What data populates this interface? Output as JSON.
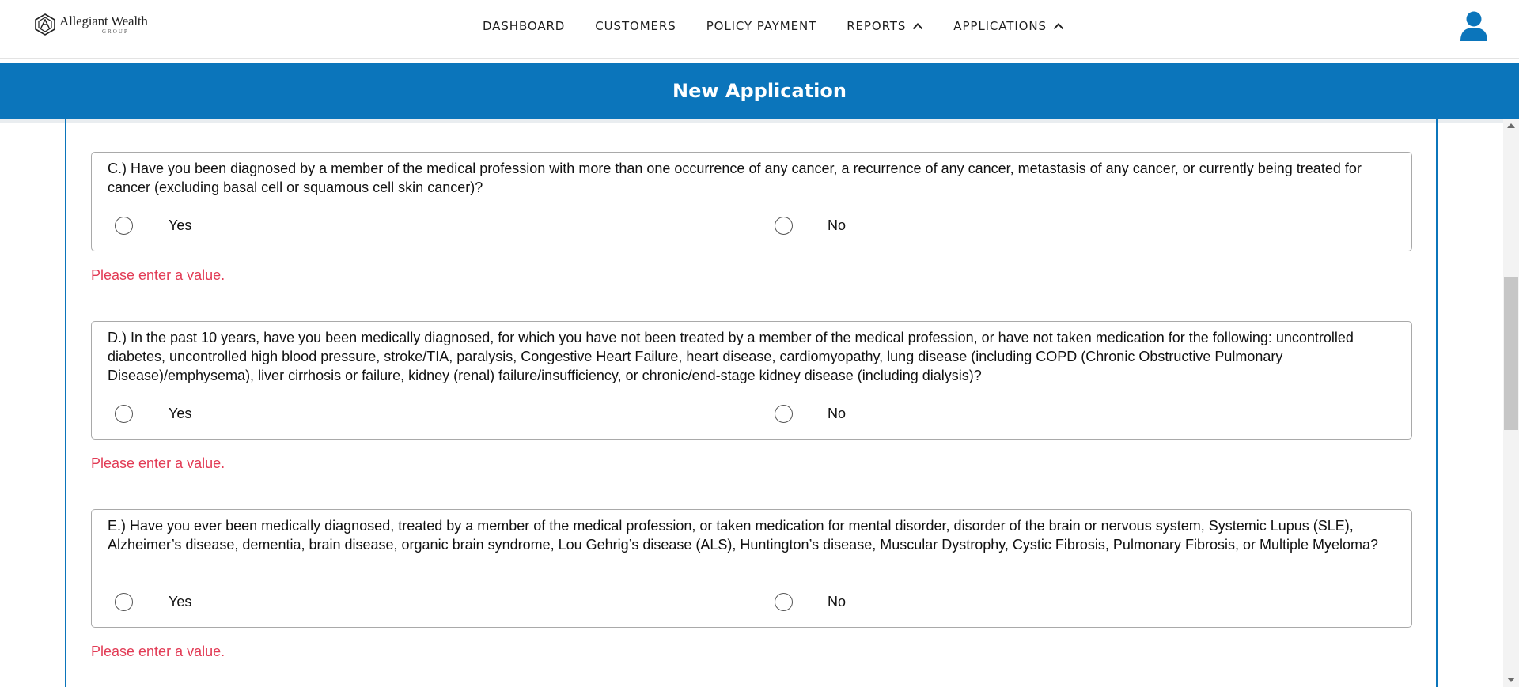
{
  "brand": {
    "name": "Allegiant Wealth",
    "sub": "GROUP"
  },
  "nav": [
    {
      "label": "DASHBOARD",
      "has_chevron": false
    },
    {
      "label": "CUSTOMERS",
      "has_chevron": false
    },
    {
      "label": "POLICY PAYMENT",
      "has_chevron": false
    },
    {
      "label": "REPORTS",
      "has_chevron": true
    },
    {
      "label": "APPLICATIONS",
      "has_chevron": true
    }
  ],
  "banner": {
    "title": "New Application"
  },
  "questions": [
    {
      "text": "C.) Have you been diagnosed by a member of the medical profession with more than one occurrence of any cancer, a recurrence of any cancer, metastasis of any cancer, or currently being treated for cancer (excluding basal cell or squamous cell skin cancer)?",
      "yes_label": "Yes",
      "no_label": "No",
      "error": "Please enter a value."
    },
    {
      "text": "D.) In the past 10 years, have you been medically diagnosed, for which you have not been treated by a member of the medical profession, or have not taken medication for the following: uncontrolled diabetes, uncontrolled high blood pressure, stroke/TIA, paralysis, Congestive Heart Failure, heart disease, cardiomyopathy, lung disease (including COPD (Chronic Obstructive Pulmonary Disease)/emphysema), liver cirrhosis or failure, kidney (renal) failure/insufficiency, or chronic/end-stage kidney disease (including dialysis)?",
      "yes_label": "Yes",
      "no_label": "No",
      "error": "Please enter a value."
    },
    {
      "text": "E.) Have you ever been medically diagnosed, treated by a member of the medical profession, or taken medication for mental disorder, disorder of the brain or nervous system, Systemic Lupus (SLE), Alzheimer’s disease, dementia, brain disease, organic brain syndrome, Lou Gehrig’s disease (ALS), Huntington’s disease, Muscular Dystrophy, Cystic Fibrosis, Pulmonary Fibrosis, or Multiple Myeloma?",
      "yes_label": "Yes",
      "no_label": "No",
      "error": "Please enter a value."
    }
  ],
  "colors": {
    "primary": "#0b75bb",
    "error": "#e23b55",
    "border": "#a9a9a9"
  },
  "icons": {
    "logo": "brand-logo-icon",
    "chevron": "chevron-up-icon",
    "user": "user-account-icon"
  }
}
